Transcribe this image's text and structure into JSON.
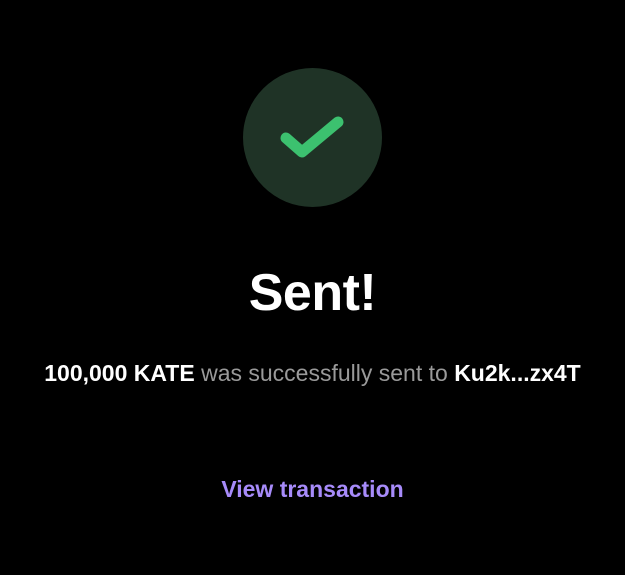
{
  "status": {
    "icon": "checkmark-icon",
    "title": "Sent!"
  },
  "message": {
    "amount": "100,000 KATE",
    "text_before_recipient": " was successfully sent to ",
    "recipient": "Ku2k...zx4T"
  },
  "actions": {
    "view_transaction_label": "View transaction"
  },
  "colors": {
    "background": "#000000",
    "circle": "#1f3326",
    "check": "#3cc16f",
    "link": "#a78bfa",
    "muted_text": "#9a9a9a"
  }
}
